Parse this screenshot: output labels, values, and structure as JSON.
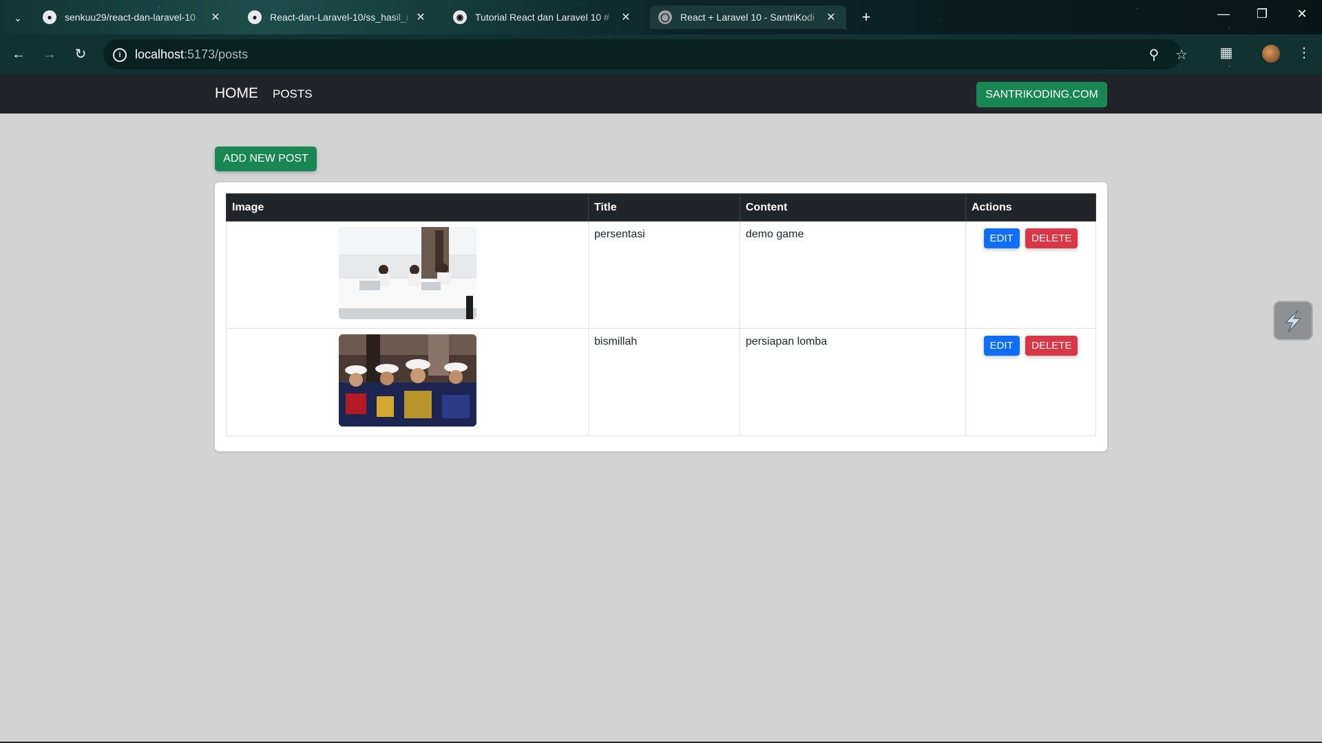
{
  "browser": {
    "tabs": [
      {
        "title": "senkuu29/react-dan-laravel-10",
        "icon": "github-icon",
        "active": false
      },
      {
        "title": "React-dan-Laravel-10/ss_hasil_r",
        "icon": "github-icon",
        "active": false
      },
      {
        "title": "Tutorial React dan Laravel 10 #",
        "icon": "discord-icon",
        "active": false
      },
      {
        "title": "React + Laravel 10 - SantriKodi",
        "icon": "globe-icon",
        "active": true
      }
    ],
    "url_host": "localhost",
    "url_path": ":5173/posts"
  },
  "navbar": {
    "brand": "HOME",
    "links": [
      "POSTS"
    ],
    "site_button": "SANTRIKODING.COM"
  },
  "main": {
    "add_button": "ADD NEW POST",
    "table": {
      "headers": [
        "Image",
        "Title",
        "Content",
        "Actions"
      ],
      "rows": [
        {
          "title": "persentasi",
          "content": "demo game",
          "image_desc": "presentation-photo"
        },
        {
          "title": "bismillah",
          "content": "persiapan lomba",
          "image_desc": "uniform-band-photo"
        }
      ],
      "edit_label": "EDIT",
      "delete_label": "DELETE"
    }
  },
  "colors": {
    "navbar_bg": "#212529",
    "success": "#198754",
    "primary": "#0d6efd",
    "danger": "#dc3545",
    "page_bg": "#d3d3d3"
  }
}
